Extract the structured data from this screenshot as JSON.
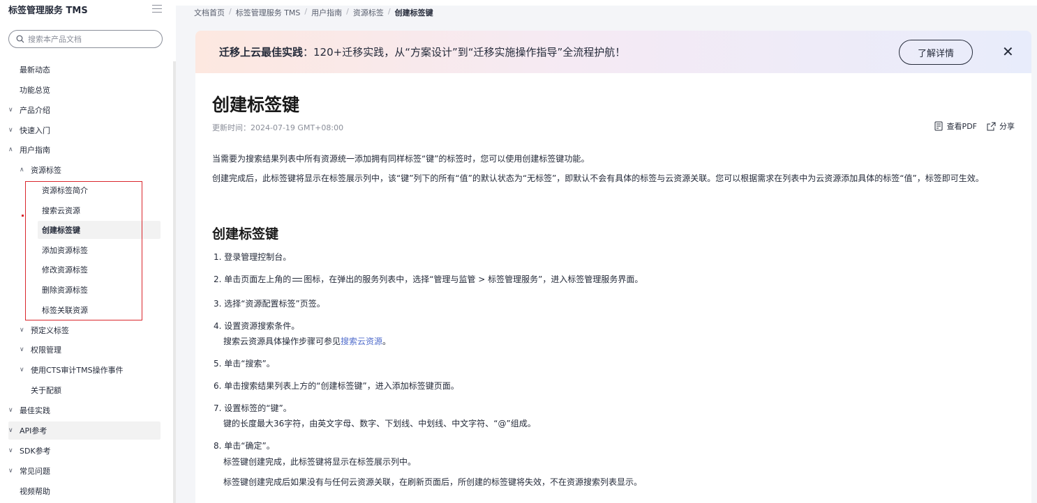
{
  "sidebar": {
    "title": "标签管理服务 TMS",
    "search_placeholder": "搜索本产品文档",
    "items": [
      {
        "label": "最新动态",
        "chev": ""
      },
      {
        "label": "功能总览",
        "chev": ""
      },
      {
        "label": "产品介绍",
        "chev": "∨"
      },
      {
        "label": "快速入门",
        "chev": "∨"
      },
      {
        "label": "用户指南",
        "chev": "∧"
      },
      {
        "label": "资源标签",
        "chev": "∧"
      },
      {
        "label": "资源标签简介",
        "chev": ""
      },
      {
        "label": "搜索云资源",
        "chev": ""
      },
      {
        "label": "创建标签键",
        "chev": ""
      },
      {
        "label": "添加资源标签",
        "chev": ""
      },
      {
        "label": "修改资源标签",
        "chev": ""
      },
      {
        "label": "删除资源标签",
        "chev": ""
      },
      {
        "label": "标签关联资源",
        "chev": ""
      },
      {
        "label": "预定义标签",
        "chev": "∨"
      },
      {
        "label": "权限管理",
        "chev": "∨"
      },
      {
        "label": "使用CTS审计TMS操作事件",
        "chev": "∨"
      },
      {
        "label": "关于配额",
        "chev": ""
      },
      {
        "label": "最佳实践",
        "chev": "∨"
      },
      {
        "label": "API参考",
        "chev": "∨"
      },
      {
        "label": "SDK参考",
        "chev": "∨"
      },
      {
        "label": "常见问题",
        "chev": "∨"
      },
      {
        "label": "视频帮助",
        "chev": ""
      }
    ]
  },
  "breadcrumb": [
    "文档首页",
    "标签管理服务 TMS",
    "用户指南",
    "资源标签",
    "创建标签键"
  ],
  "banner": {
    "bold": "迁移上云最佳实践",
    "text": "：120+迁移实践，从“方案设计”到“迁移实施操作指导”全流程护航！",
    "button": "了解详情",
    "close": "✕"
  },
  "article": {
    "title": "创建标签键",
    "updated": "更新时间：2024-07-19 GMT+08:00",
    "view_pdf": "查看PDF",
    "share": "分享",
    "intro1": "当需要为搜索结果列表中所有资源统一添加拥有同样标签“键”的标签时，您可以使用创建标签键功能。",
    "intro2": "创建完成后，此标签键将显示在标签展示列中，该“键”列下的所有“值”的默认状态为“无标签”，即默认不会有具体的标签与云资源关联。您可以根据需求在列表中为云资源添加具体的标签“值”，标签即可生效。",
    "section_title": "创建标签键",
    "steps": {
      "s1": "1. 登录管理控制台。",
      "s2a": "2. 单击页面左上角的",
      "s2b": "图标，在弹出的服务列表中，选择“管理与监管 > 标签管理服务”，进入标签管理服务界面。",
      "s3": "3. 选择“资源配置标签”页签。",
      "s4": "4. 设置资源搜索条件。",
      "s4_sub_a": "搜索云资源具体操作步骤可参见",
      "s4_sub_link": "搜索云资源",
      "s4_sub_b": "。",
      "s5": "5. 单击“搜索”。",
      "s6": "6. 单击搜索结果列表上方的“创建标签键”，进入添加标签键页面。",
      "s7": "7. 设置标签的“键”。",
      "s7_sub": "键的长度最大36字符，由英文字母、数字、下划线、中划线、中文字符、“@”组成。",
      "s8": "8. 单击“确定”。",
      "s8_sub1": "标签键创建完成，此标签键将显示在标签展示列中。",
      "s8_sub2": "标签键创建完成后如果没有与任何云资源关联，在刷新页面后，所创建的标签键将失效，不在资源搜索列表显示。"
    }
  }
}
